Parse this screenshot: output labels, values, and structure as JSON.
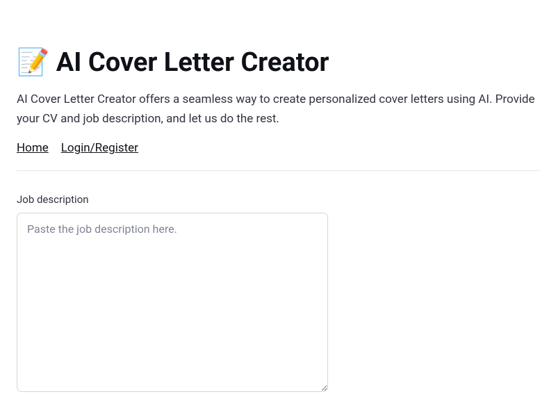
{
  "header": {
    "title": "📝 AI Cover Letter Creator",
    "subtitle": "AI Cover Letter Creator offers a seamless way to create personalized cover letters using AI. Provide your CV and job description, and let us do the rest."
  },
  "nav": {
    "home": "Home",
    "login": "Login/Register"
  },
  "form": {
    "job_description_label": "Job description",
    "job_description_placeholder": "Paste the job description here."
  }
}
